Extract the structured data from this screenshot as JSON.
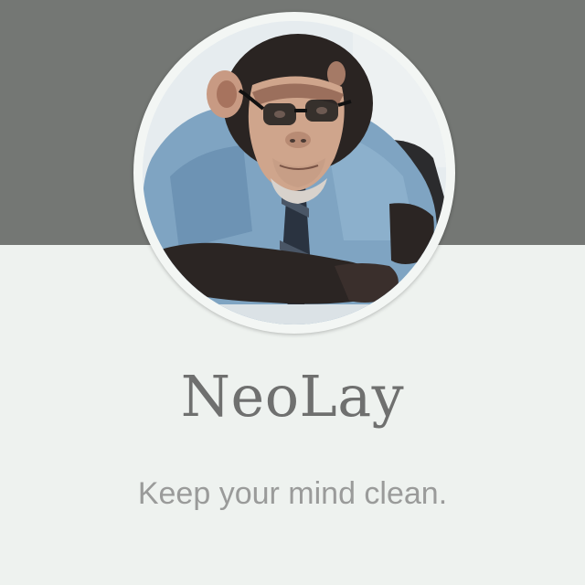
{
  "header": {
    "avatar_icon": "chimpanzee-avatar-icon"
  },
  "profile": {
    "name": "NeoLay",
    "tagline": "Keep your mind clean."
  },
  "colors": {
    "header_band": "#747774",
    "background": "#eef2ef",
    "title": "#6f706f",
    "tagline": "#9a9b9a"
  }
}
